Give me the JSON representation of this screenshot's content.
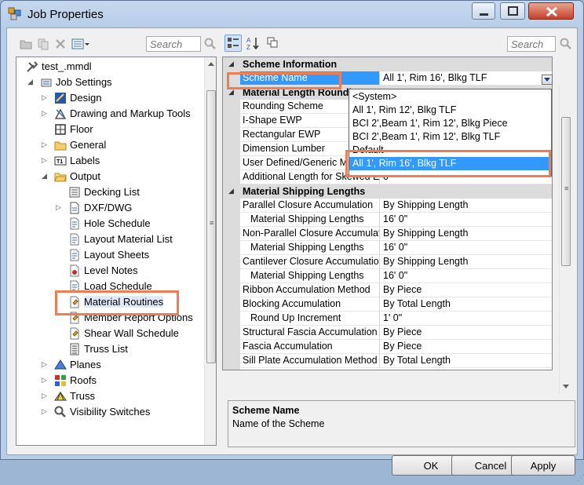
{
  "window": {
    "title": "Job Properties"
  },
  "left_toolbar": {
    "search_placeholder": "Search"
  },
  "right_toolbar": {
    "search_placeholder": "Search"
  },
  "tree": {
    "items": [
      {
        "label": "test_.mmdl",
        "icon": "tools-icon",
        "expander": "none"
      },
      {
        "label": "Job Settings",
        "icon": "settings-icon",
        "expander": "expanded"
      },
      {
        "label": "Design",
        "icon": "design-icon",
        "expander": "collapsed"
      },
      {
        "label": "Drawing and Markup Tools",
        "icon": "drawing-tools-icon",
        "expander": "collapsed"
      },
      {
        "label": "Floor",
        "icon": "floor-icon",
        "expander": "none"
      },
      {
        "label": "General",
        "icon": "folder-icon",
        "expander": "collapsed"
      },
      {
        "label": "Labels",
        "icon": "labels-icon",
        "expander": "collapsed"
      },
      {
        "label": "Output",
        "icon": "folder-open-icon",
        "expander": "expanded"
      },
      {
        "label": "Decking List",
        "icon": "list-icon",
        "expander": "none"
      },
      {
        "label": "DXF/DWG",
        "icon": "dxf-icon",
        "expander": "collapsed"
      },
      {
        "label": "Hole Schedule",
        "icon": "document-icon",
        "expander": "none"
      },
      {
        "label": "Layout Material List",
        "icon": "document-icon",
        "expander": "none"
      },
      {
        "label": "Layout Sheets",
        "icon": "document-icon",
        "expander": "none"
      },
      {
        "label": "Level Notes",
        "icon": "notes-icon",
        "expander": "none"
      },
      {
        "label": "Load Schedule",
        "icon": "document-icon",
        "expander": "none"
      },
      {
        "label": "Material Routines",
        "icon": "routines-icon",
        "expander": "none"
      },
      {
        "label": "Member Report Options",
        "icon": "routines-icon",
        "expander": "none"
      },
      {
        "label": "Shear Wall Schedule",
        "icon": "routines-icon",
        "expander": "none"
      },
      {
        "label": "Truss List",
        "icon": "truss-list-icon",
        "expander": "none"
      },
      {
        "label": "Planes",
        "icon": "planes-icon",
        "expander": "collapsed"
      },
      {
        "label": "Roofs",
        "icon": "roofs-icon",
        "expander": "collapsed"
      },
      {
        "label": "Truss",
        "icon": "truss-icon",
        "expander": "collapsed"
      },
      {
        "label": "Visibility Switches",
        "icon": "visibility-icon",
        "expander": "collapsed"
      }
    ],
    "selected": "Material Routines"
  },
  "grid": {
    "categories": {
      "scheme": "Scheme Information",
      "length": "Material Length Rounding",
      "shipping": "Material Shipping Lengths"
    },
    "scheme_rows": [
      {
        "name": "Scheme Name",
        "value": "All 1', Rim 16', Blkg TLF"
      }
    ],
    "length_rows": [
      {
        "name": "Rounding Scheme",
        "value": ""
      },
      {
        "name": "I-Shape EWP",
        "value": ""
      },
      {
        "name": "Rectangular EWP",
        "value": ""
      },
      {
        "name": "Dimension Lumber",
        "value": ""
      },
      {
        "name": "User Defined/Generic M",
        "value": ""
      },
      {
        "name": "Additional Length for Skewed E",
        "value": "0"
      }
    ],
    "shipping_rows": [
      {
        "name": "Parallel Closure Accumulation",
        "value": "By Shipping Length",
        "sub": false
      },
      {
        "name": "Material Shipping Lengths",
        "value": "16' 0\"",
        "sub": true
      },
      {
        "name": "Non-Parallel Closure Accumulation",
        "value": "By Shipping Length",
        "sub": false
      },
      {
        "name": "Material Shipping Lengths",
        "value": "16' 0\"",
        "sub": true
      },
      {
        "name": "Cantilever Closure Accumulation",
        "value": "By Shipping Length",
        "sub": false
      },
      {
        "name": "Material Shipping Lengths",
        "value": "16' 0\"",
        "sub": true
      },
      {
        "name": "Ribbon Accumulation Method",
        "value": "By Piece",
        "sub": false
      },
      {
        "name": "Blocking Accumulation",
        "value": "By Total Length",
        "sub": false
      },
      {
        "name": "Round Up Increment",
        "value": "1' 0\"",
        "sub": true
      },
      {
        "name": "Structural Fascia Accumulation",
        "value": "By Piece",
        "sub": false
      },
      {
        "name": "Fascia Accumulation",
        "value": "By Piece",
        "sub": false
      },
      {
        "name": "Sill Plate Accumulation Method",
        "value": "By Total Length",
        "sub": false
      }
    ]
  },
  "dropdown": {
    "options": [
      "<System>",
      "All 1', Rim 12', Blkg TLF",
      "BCI 2',Beam 1', Rim 12', Blkg Piece",
      "BCI 2',Beam 1', Rim 12', Blkg TLF",
      "Default",
      "All 1', Rim 16', Blkg TLF"
    ],
    "selected_index": 5
  },
  "description": {
    "title": "Scheme Name",
    "text": "Name of the Scheme"
  },
  "buttons": {
    "ok": "OK",
    "cancel": "Cancel",
    "apply": "Apply"
  },
  "colors": {
    "highlight": "#ee7d54",
    "selection": "#3399ff"
  }
}
